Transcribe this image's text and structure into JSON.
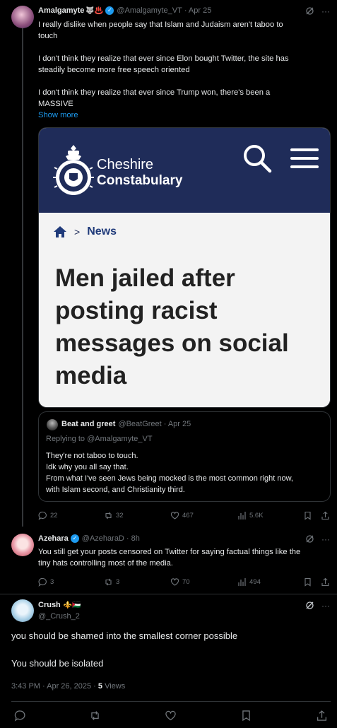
{
  "tweet1": {
    "name": "Amalgamyte",
    "emojis": "🐺♨️",
    "handle": "@Amalgamyte_VT",
    "time": "· Apr 25",
    "lines": [
      "I really dislike when people say that Islam and Judaism aren't taboo to",
      "touch",
      "",
      "I don't think they realize that ever since Elon bought Twitter, the site has",
      "steadily become more free speech oriented",
      "",
      "I don't think they realize that ever since Trump won, there's been a",
      "MASSIVE"
    ],
    "show_more": "Show more",
    "card": {
      "brand_line1": "Cheshire",
      "brand_line2": "Constabulary",
      "crumb": "News",
      "crumb_sep": ">",
      "headline": "Men jailed after posting racist messages on social media"
    },
    "quote": {
      "name": "Beat and greet",
      "handle": "@BeatGreet",
      "time": "· Apr 25",
      "replying_to": "Replying to @Amalgamyte_VT",
      "lines": [
        "They're not taboo to touch.",
        "Idk why you all say that.",
        "From what I've seen Jews being mocked is the most common right now,",
        "with Islam second, and Christianity third."
      ]
    },
    "stats": {
      "replies": "22",
      "reposts": "32",
      "likes": "467",
      "views": "5.6K"
    }
  },
  "tweet2": {
    "name": "Azehara",
    "handle": "@AzeharaD",
    "time": "· 8h",
    "lines": [
      "You still get your posts censored on Twitter for saying factual things like the",
      "tiny hats controlling most of the media."
    ],
    "stats": {
      "replies": "3",
      "reposts": "3",
      "likes": "70",
      "views": "494"
    }
  },
  "tweet3": {
    "name": "Crush",
    "emojis": "⚜️🇵🇸",
    "handle": "@_Crush_2",
    "line1": "you should be shamed into the smallest corner possible",
    "line2": "You should be isolated",
    "timestamp": "3:43 PM · Apr 26, 2025 ·",
    "views_count": "5",
    "views_label": "Views"
  },
  "colors": {
    "accent": "#1d9bf0",
    "muted": "#71767b",
    "card_navy": "#1f2c59"
  }
}
